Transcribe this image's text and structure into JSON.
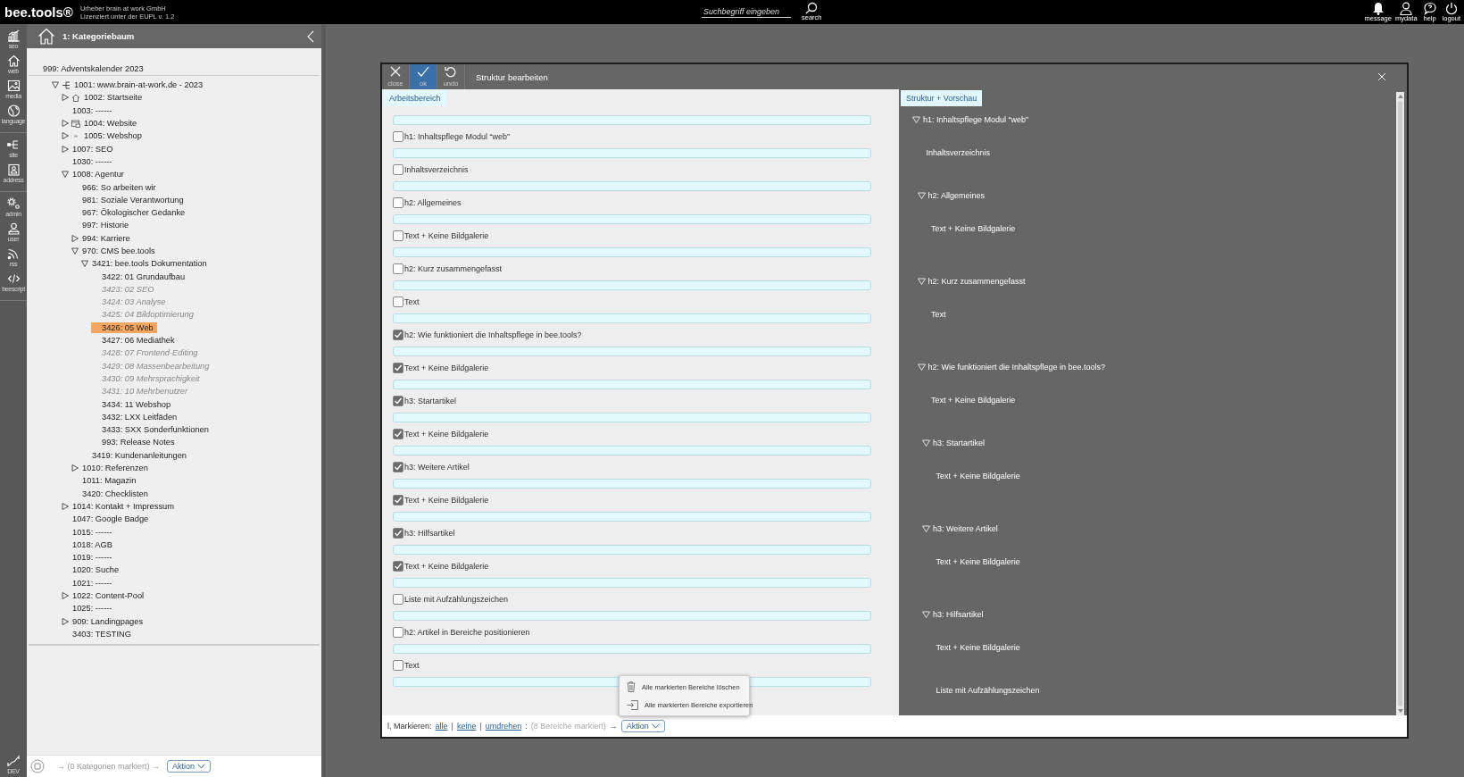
{
  "topbar": {
    "logo": "bee.tools®",
    "license": [
      "Urheber brain at work GmbH",
      "Lizenziert unter der EUPL v. 1.2"
    ],
    "search": {
      "placeholder": "Suchbegriff eingeben",
      "button": "search"
    },
    "nav": [
      {
        "label": "message",
        "kind": "bell"
      },
      {
        "label": "mydata",
        "kind": "person"
      },
      {
        "label": "help",
        "kind": "bubble"
      },
      {
        "label": "logout",
        "kind": "power"
      }
    ]
  },
  "rail": {
    "groups": [
      {
        "items": [
          {
            "label": "seo",
            "kind": "chart"
          },
          {
            "label": "web",
            "kind": "home"
          },
          {
            "label": "media",
            "kind": "image"
          },
          {
            "label": "language",
            "kind": "globe"
          }
        ]
      },
      {
        "items": [
          {
            "label": "site",
            "kind": "share"
          },
          {
            "label": "address",
            "kind": "contact"
          }
        ]
      },
      {
        "items": [
          {
            "label": "admin",
            "kind": "gears"
          },
          {
            "label": "user",
            "kind": "user"
          },
          {
            "label": "rss",
            "kind": "rss"
          },
          {
            "label": "beescript",
            "kind": "code"
          }
        ]
      }
    ],
    "bottom": {
      "label": "DEV",
      "kind": "dev"
    }
  },
  "tree": {
    "title": "1: Kategoriebaum",
    "pinned": {
      "label": "999: Adventskalender 2023"
    },
    "items": [
      {
        "label": "1001: www.brain-at-work.de - 2023",
        "kind": "site",
        "expanded": true,
        "selected": false,
        "children": [
          {
            "label": "1002: Startseite",
            "kind": "home",
            "expanded": false,
            "selected": false
          },
          {
            "label": "1003: ------",
            "selected": false
          },
          {
            "label": "1004: Website",
            "kind": "window",
            "expanded": false,
            "selected": false
          },
          {
            "label": "1005: Webshop",
            "kind": "dash",
            "expanded": false,
            "selected": false
          },
          {
            "label": "1007: SEO",
            "expanded": false,
            "selected": false
          },
          {
            "label": "1030: ------",
            "selected": false
          },
          {
            "label": "1008: Agentur",
            "expanded": true,
            "selected": false,
            "children": [
              {
                "label": "966: So arbeiten wir",
                "selected": false
              },
              {
                "label": "981: Soziale Verantwortung",
                "selected": false
              },
              {
                "label": "967: Ökologischer Gedanke",
                "selected": false
              },
              {
                "label": "997: Historie",
                "selected": false
              },
              {
                "label": "994: Karriere",
                "expanded": false,
                "selected": false
              },
              {
                "label": "970: CMS bee.tools",
                "expanded": true,
                "selected": false,
                "children": [
                  {
                    "label": "3421: bee.tools Dokumentation",
                    "expanded": true,
                    "selected": false,
                    "children": [
                      {
                        "label": "3422: 01 Grundaufbau",
                        "inactive": false,
                        "selected": false
                      },
                      {
                        "label": "3423: 02 SEO",
                        "inactive": true,
                        "selected": false
                      },
                      {
                        "label": "3424: 03 Analyse",
                        "inactive": true,
                        "selected": false
                      },
                      {
                        "label": "3425: 04 Bildoptimierung",
                        "inactive": true,
                        "selected": false
                      },
                      {
                        "label": "3426: 05 Web",
                        "inactive": false,
                        "selected": true
                      },
                      {
                        "label": "3427: 06 Mediathek",
                        "inactive": false,
                        "selected": false
                      },
                      {
                        "label": "3428: 07 Frontend-Editing",
                        "inactive": true,
                        "selected": false
                      },
                      {
                        "label": "3429: 08 Massenbearbeitung",
                        "inactive": true,
                        "selected": false
                      },
                      {
                        "label": "3430: 09 Mehrsprachigkeit",
                        "inactive": true,
                        "selected": false
                      },
                      {
                        "label": "3431: 10 Mehrbenutzer",
                        "inactive": true,
                        "selected": false
                      },
                      {
                        "label": "3434: 11 Webshop",
                        "inactive": false,
                        "selected": false
                      },
                      {
                        "label": "3432: LXX Leitfäden",
                        "inactive": false,
                        "selected": false
                      },
                      {
                        "label": "3433: SXX Sonderfunktionen",
                        "inactive": false,
                        "selected": false
                      },
                      {
                        "label": "993: Release Notes",
                        "inactive": false,
                        "selected": false
                      }
                    ]
                  },
                  {
                    "label": "3419: Kundenanleitungen",
                    "selected": false
                  }
                ]
              },
              {
                "label": "1010: Referenzen",
                "expanded": false,
                "selected": false
              },
              {
                "label": "1011: Magazin",
                "selected": false
              },
              {
                "label": "3420: Checklisten",
                "selected": false
              }
            ]
          },
          {
            "label": "1014: Kontakt + Impressum",
            "expanded": false,
            "selected": false
          },
          {
            "label": "1047: Google Badge",
            "selected": false
          },
          {
            "label": "1015: ------",
            "selected": false
          },
          {
            "label": "1018: AGB",
            "selected": false
          },
          {
            "label": "1019: ------",
            "selected": false
          },
          {
            "label": "1020: Suche",
            "selected": false
          },
          {
            "label": "1021: ------",
            "selected": false
          },
          {
            "label": "1022: Content-Pool",
            "expanded": false,
            "selected": false
          },
          {
            "label": "1025: ------",
            "selected": false
          },
          {
            "label": "909: Landingpages",
            "expanded": false,
            "selected": false
          },
          {
            "label": "3403: TESTING",
            "selected": false
          }
        ]
      }
    ],
    "footer": {
      "status": "→ (0 Kategorien markiert) →",
      "action": "Aktion"
    }
  },
  "dialog": {
    "title": "Struktur bearbeiten",
    "tools": [
      {
        "label": "close",
        "kind": "close",
        "selected": false
      },
      {
        "label": "ok",
        "kind": "ok",
        "selected": true
      },
      {
        "label": "undo",
        "kind": "undo",
        "selected": false
      }
    ],
    "work_tab": "Arbeitsbereich",
    "preview_tab": "Struktur + Vorschau",
    "blocks": [
      {
        "label": "h1: Inhaltspflege Modul “web”",
        "checked": false
      },
      {
        "label": "Inhaltsverzeichnis",
        "checked": false
      },
      {
        "label": "h2: Allgemeines",
        "checked": false
      },
      {
        "label": "Text + Keine Bildgalerie",
        "checked": false
      },
      {
        "label": "h2: Kurz zusammengefasst",
        "checked": false
      },
      {
        "label": "Text",
        "checked": false
      },
      {
        "label": "h2: Wie funktioniert die Inhaltspflege in bee.tools?",
        "checked": true
      },
      {
        "label": "Text + Keine Bildgalerie",
        "checked": true
      },
      {
        "label": "h3: Startartikel",
        "checked": true
      },
      {
        "label": "Text + Keine Bildgalerie",
        "checked": true
      },
      {
        "label": "h3: Weitere Artikel",
        "checked": true
      },
      {
        "label": "Text + Keine Bildgalerie",
        "checked": true
      },
      {
        "label": "h3: Hilfsartikel",
        "checked": true
      },
      {
        "label": "Text + Keine Bildgalerie",
        "checked": true
      },
      {
        "label": "Liste mit Aufzählungszeichen",
        "checked": false
      },
      {
        "label": "h2: Artikel in Bereiche positionieren",
        "checked": false
      },
      {
        "label": "Text",
        "checked": false
      }
    ],
    "preview": [
      {
        "label": "h1: Inhaltspflege Modul “web”",
        "kind": "heading",
        "expanded": true,
        "children": [
          {
            "label": "Inhaltsverzeichnis",
            "kind": "text"
          },
          {
            "label": "h2: Allgemeines",
            "kind": "heading",
            "expanded": true,
            "children": [
              {
                "label": "Text + Keine Bildgalerie",
                "kind": "text"
              }
            ]
          },
          {
            "label": "h2: Kurz zusammengefasst",
            "kind": "heading",
            "expanded": true,
            "children": [
              {
                "label": "Text",
                "kind": "text"
              }
            ]
          },
          {
            "label": "h2: Wie funktioniert die Inhaltspflege in bee.tools?",
            "kind": "heading",
            "expanded": true,
            "children": [
              {
                "label": "Text + Keine Bildgalerie",
                "kind": "text"
              },
              {
                "label": "h3: Startartikel",
                "kind": "heading",
                "expanded": true,
                "children": [
                  {
                    "label": "Text + Keine Bildgalerie",
                    "kind": "text"
                  }
                ]
              },
              {
                "label": "h3: Weitere Artikel",
                "kind": "heading",
                "expanded": true,
                "children": [
                  {
                    "label": "Text + Keine Bildgalerie",
                    "kind": "text"
                  }
                ]
              },
              {
                "label": "h3: Hilfsartikel",
                "kind": "heading",
                "expanded": true,
                "children": [
                  {
                    "label": "Text + Keine Bildgalerie",
                    "kind": "text"
                  },
                  {
                    "label": "Liste mit Aufzählungszeichen",
                    "kind": "text"
                  }
                ]
              }
            ]
          }
        ]
      }
    ],
    "footer": [
      {
        "kind": "label",
        "text": "l, Markieren:"
      },
      {
        "kind": "link",
        "text": "alle"
      },
      {
        "kind": "sep",
        "text": "|"
      },
      {
        "kind": "link",
        "text": "keine"
      },
      {
        "kind": "sep",
        "text": "|"
      },
      {
        "kind": "link",
        "text": "umdrehen"
      },
      {
        "kind": "sep",
        "text": ":"
      },
      {
        "kind": "count",
        "text": "(8 Bereiche markiert)"
      },
      {
        "kind": "sep",
        "text": "→"
      }
    ],
    "action": "Aktion",
    "menu": [
      {
        "label": "Alle markierten Bereiche löschen",
        "kind": "delete"
      },
      {
        "label": "Alle markierten Bereiche exportieren",
        "kind": "export"
      }
    ]
  }
}
